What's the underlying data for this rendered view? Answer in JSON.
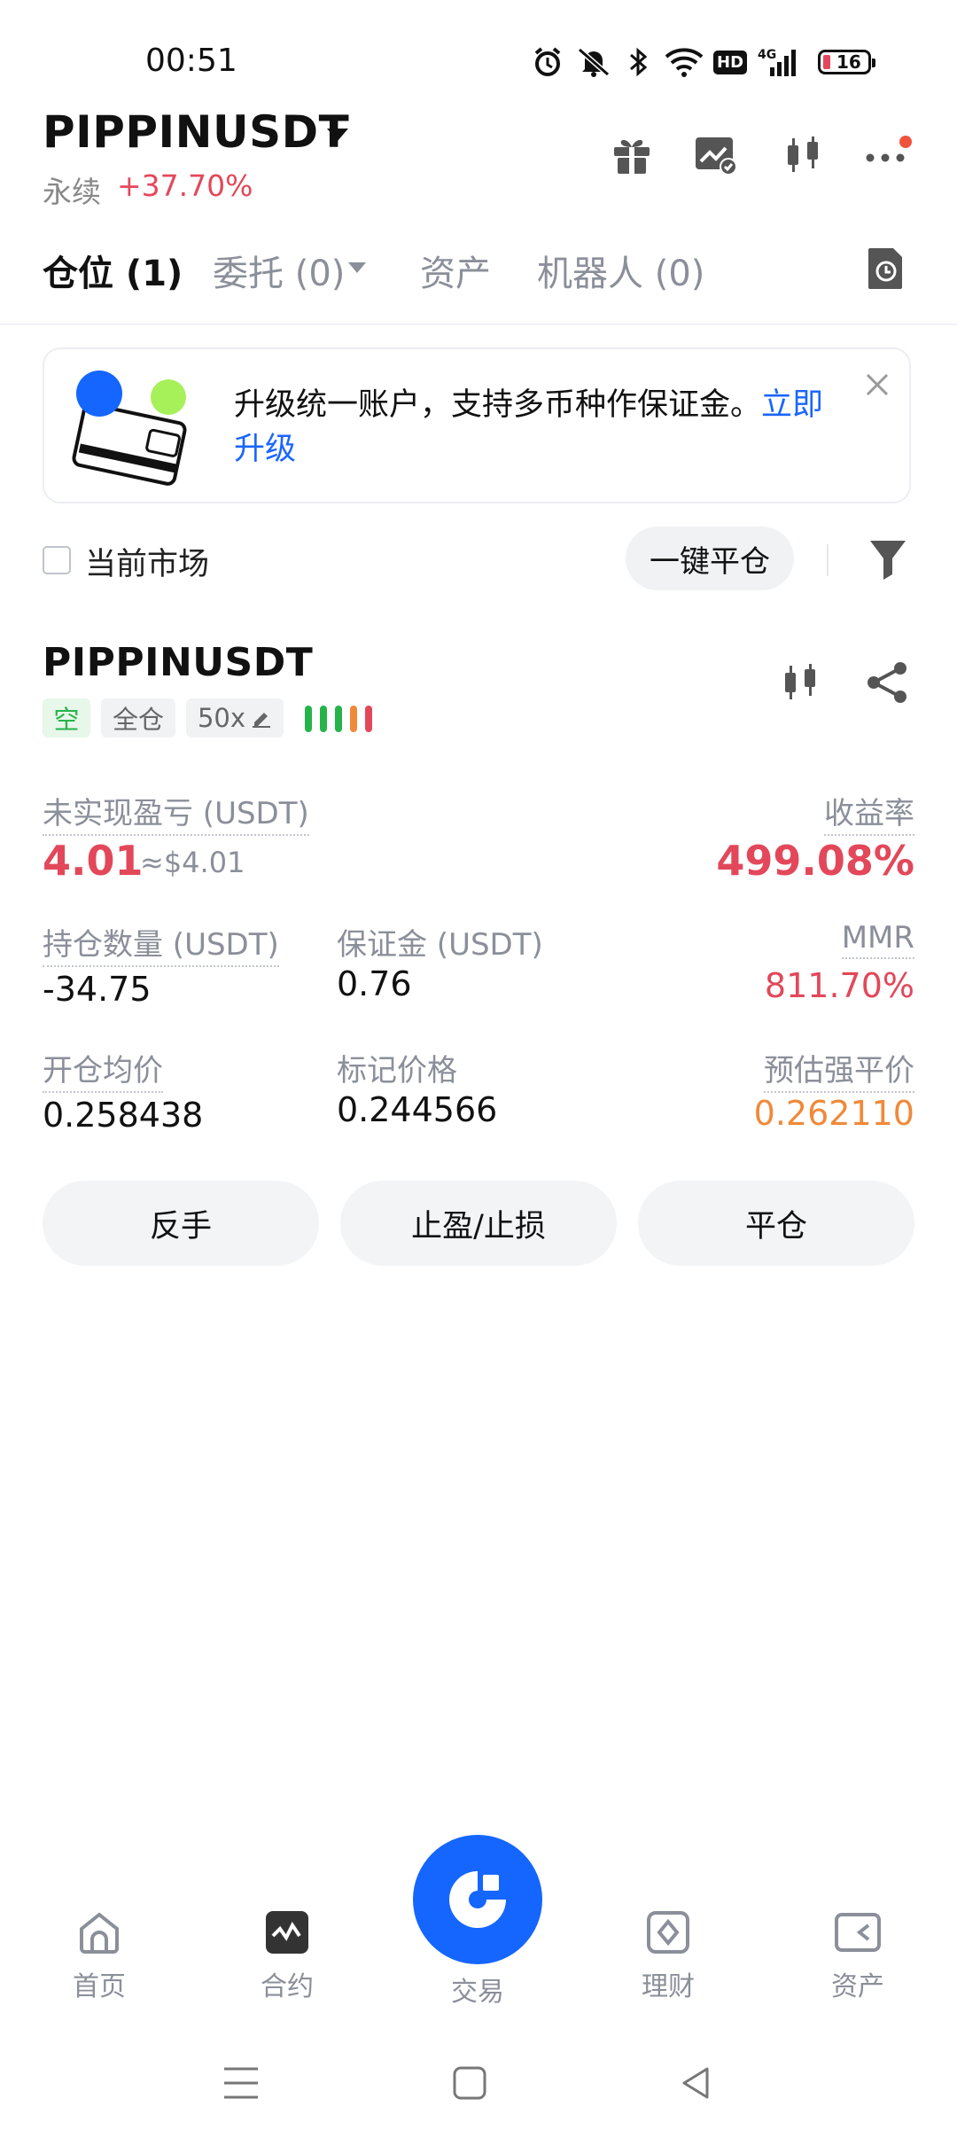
{
  "status_bar": {
    "time": "00:51",
    "battery": "16",
    "network": "4G",
    "hd": "HD",
    "icons": [
      "alarm-icon",
      "mute-icon",
      "bluetooth-icon",
      "wifi-icon",
      "hd-icon",
      "signal-icon",
      "battery-icon"
    ]
  },
  "header": {
    "pair": "PIPPINUSDT",
    "type": "永续",
    "change": "+37.70%",
    "icons": [
      "gift-icon",
      "chart-icon",
      "candlestick-icon",
      "more-icon"
    ]
  },
  "tabs": [
    {
      "label": "仓位 (1)",
      "active": true
    },
    {
      "label": "委托 (0)",
      "active": false
    },
    {
      "label": "资产",
      "active": false
    },
    {
      "label": "机器人 (0)",
      "active": false
    }
  ],
  "banner": {
    "text": "升级统一账户，支持多币种作保证金。",
    "link": "立即升级"
  },
  "filter": {
    "current_market": "当前市场",
    "close_all": "一键平仓"
  },
  "position": {
    "symbol": "PIPPINUSDT",
    "side": "空",
    "margin_mode": "全仓",
    "leverage": "50x",
    "unrealized_label": "未实现盈亏 (USDT)",
    "unrealized_value": "4.01",
    "unrealized_usd": "≈$4.01",
    "roe_label": "收益率",
    "roe_value": "499.08%",
    "size_label": "持仓数量 (USDT)",
    "size_value": "-34.75",
    "margin_label": "保证金 (USDT)",
    "margin_value": "0.76",
    "mmr_label": "MMR",
    "mmr_value": "811.70%",
    "entry_label": "开仓均价",
    "entry_value": "0.258438",
    "mark_label": "标记价格",
    "mark_value": "0.244566",
    "liq_label": "预估强平价",
    "liq_value": "0.262110",
    "actions": [
      "反手",
      "止盈/止损",
      "平仓"
    ]
  },
  "bottom_nav": [
    {
      "label": "首页",
      "icon": "home-icon"
    },
    {
      "label": "合约",
      "icon": "futures-icon"
    },
    {
      "label": "交易",
      "icon": "trade-icon"
    },
    {
      "label": "理财",
      "icon": "earn-icon"
    },
    {
      "label": "资产",
      "icon": "wallet-icon"
    }
  ],
  "colors": {
    "up_red": "#e2485a",
    "accent_blue": "#1565ff",
    "long_green": "#25b34a",
    "orange": "#f08a3a"
  }
}
